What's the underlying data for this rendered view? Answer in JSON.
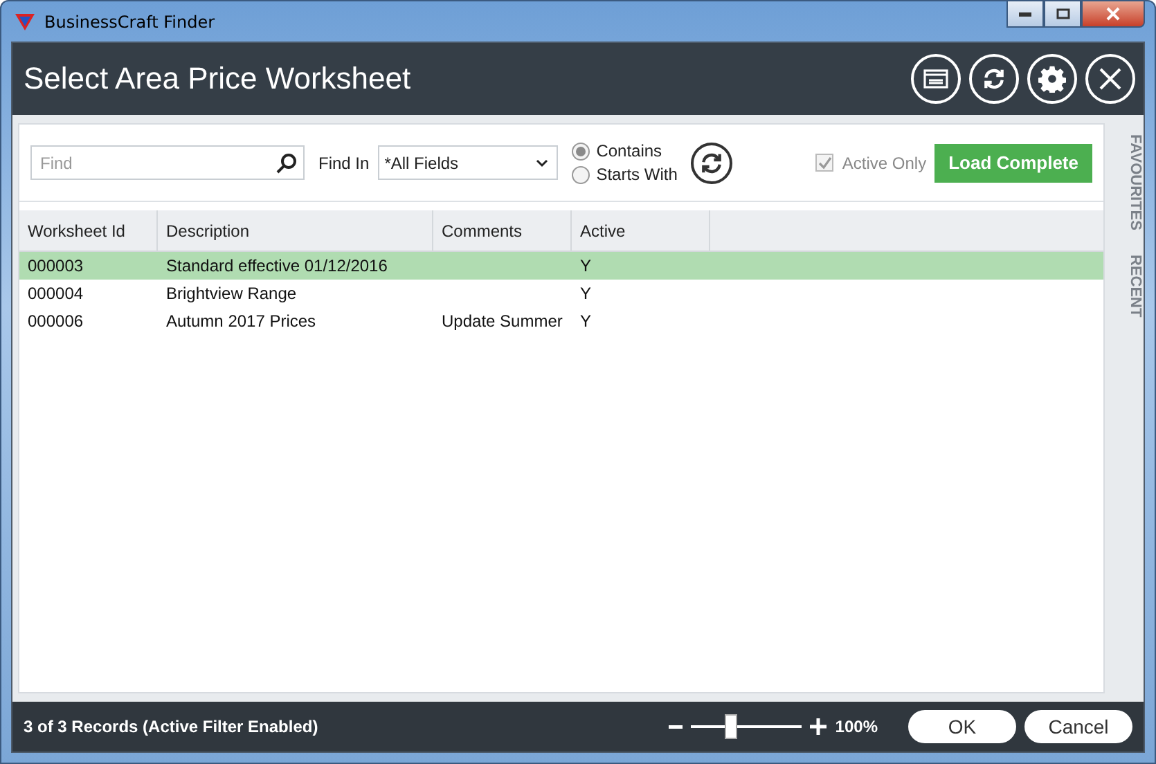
{
  "window": {
    "title": "BusinessCraft Finder"
  },
  "header": {
    "title": "Select Area Price Worksheet"
  },
  "toolbar": {
    "find": {
      "placeholder": "Find"
    },
    "find_in": {
      "label": "Find In",
      "value": "*All Fields"
    },
    "match_options": [
      {
        "label": "Contains",
        "selected": true
      },
      {
        "label": "Starts With",
        "selected": false
      }
    ],
    "active_only": {
      "label": "Active Only",
      "checked": true,
      "disabled": true
    },
    "load_button": "Load Complete"
  },
  "side_tabs": [
    "FAVOURITES",
    "RECENT"
  ],
  "table": {
    "columns": [
      "Worksheet Id",
      "Description",
      "Comments",
      "Active"
    ],
    "rows": [
      {
        "cells": [
          "000003",
          "Standard effective 01/12/2016",
          "",
          "Y"
        ],
        "selected": true
      },
      {
        "cells": [
          "000004",
          "Brightview Range",
          "",
          "Y"
        ],
        "selected": false
      },
      {
        "cells": [
          "000006",
          "Autumn 2017 Prices",
          "Update Summer",
          "Y"
        ],
        "selected": false
      }
    ]
  },
  "status_bar": {
    "text": "3 of 3 Records (Active Filter Enabled)",
    "zoom": {
      "level": 0.36,
      "reading": "100%"
    },
    "buttons": [
      "OK",
      "Cancel"
    ]
  }
}
